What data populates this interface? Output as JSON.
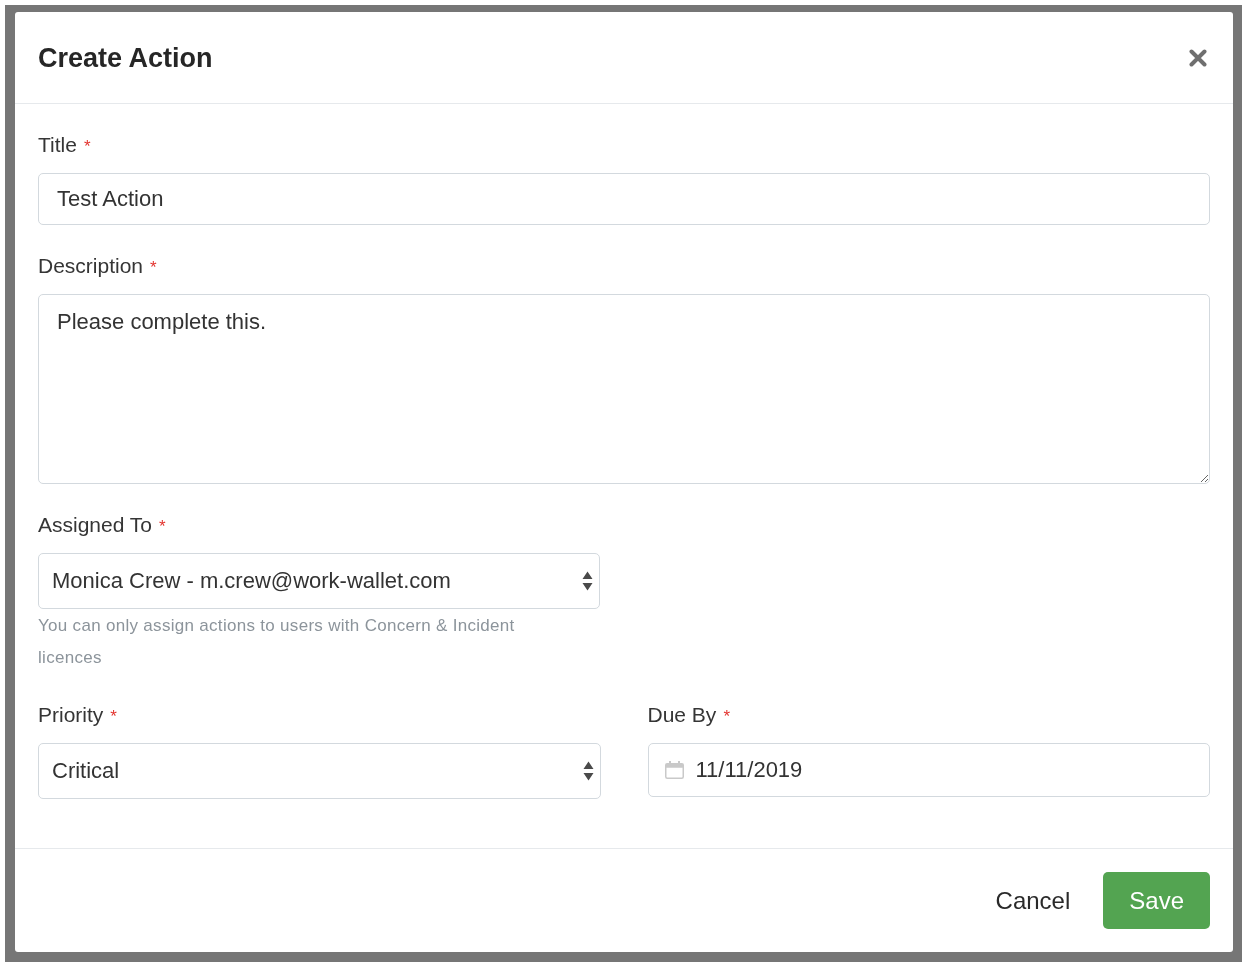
{
  "dialog": {
    "title": "Create Action"
  },
  "fields": [
    {
      "kind": "text",
      "label": "Title",
      "required_mark": "*",
      "value": "Test Action"
    },
    {
      "kind": "textarea",
      "label": "Description",
      "required_mark": "*",
      "value": "Please complete this."
    },
    {
      "kind": "select",
      "label": "Assigned To",
      "required_mark": "*",
      "value": "Monica Crew - m.crew@work-wallet.com",
      "help": "You can only assign actions to users with Concern & Incident licences"
    }
  ],
  "field_row": [
    {
      "kind": "select",
      "label": "Priority",
      "required_mark": "*",
      "value": "Critical"
    },
    {
      "kind": "date",
      "label": "Due By",
      "required_mark": "*",
      "value": "11/11/2019"
    }
  ],
  "footer": {
    "buttons": [
      {
        "kind": "plain",
        "label": "Cancel"
      },
      {
        "kind": "primary",
        "label": "Save"
      }
    ]
  }
}
